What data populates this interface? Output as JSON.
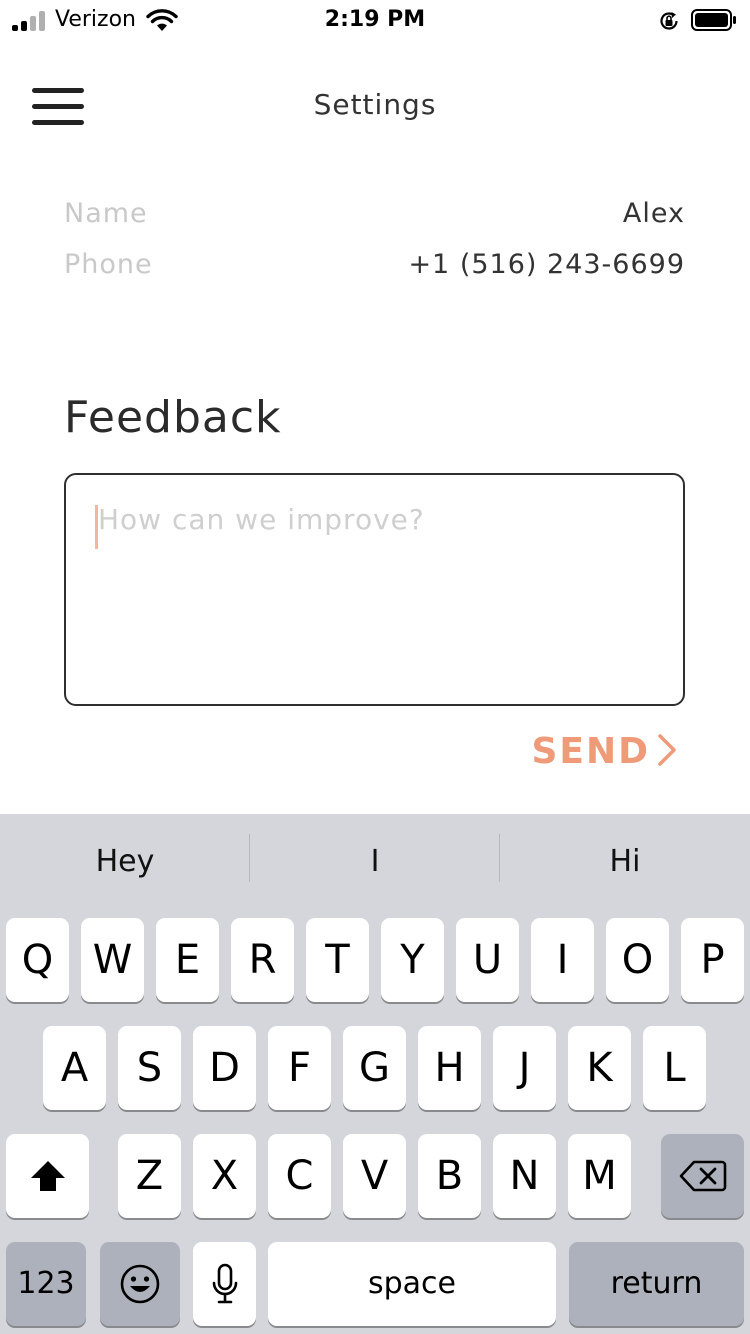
{
  "status_bar": {
    "carrier": "Verizon",
    "time": "2:19 PM",
    "signal_bars_filled": 2,
    "signal_bars_total": 4,
    "icons": [
      "cellular-signal-icon",
      "wifi-icon",
      "orientation-lock-icon",
      "battery-icon"
    ]
  },
  "header": {
    "title": "Settings",
    "menu_icon": "hamburger-menu-icon"
  },
  "profile": {
    "name_label": "Name",
    "name_value": "Alex",
    "phone_label": "Phone",
    "phone_value": "+1 (516) 243-6699"
  },
  "feedback": {
    "title": "Feedback",
    "placeholder": "How can we improve?",
    "value": "",
    "send_label": "SEND",
    "send_icon": "chevron-right-icon"
  },
  "keyboard": {
    "suggestions": [
      "Hey",
      "I",
      "Hi"
    ],
    "row1": [
      "Q",
      "W",
      "E",
      "R",
      "T",
      "Y",
      "U",
      "I",
      "O",
      "P"
    ],
    "row2": [
      "A",
      "S",
      "D",
      "F",
      "G",
      "H",
      "J",
      "K",
      "L"
    ],
    "row3": [
      "Z",
      "X",
      "C",
      "V",
      "B",
      "N",
      "M"
    ],
    "numbers_label": "123",
    "space_label": "space",
    "return_label": "return",
    "special_icons": [
      "shift-icon",
      "backspace-icon",
      "emoji-icon",
      "microphone-icon"
    ]
  },
  "colors": {
    "accent": "#ef9a78",
    "label_gray": "#c9c9c9",
    "keyboard_bg": "#d4d6dc",
    "key_dark": "#adb1bb"
  }
}
